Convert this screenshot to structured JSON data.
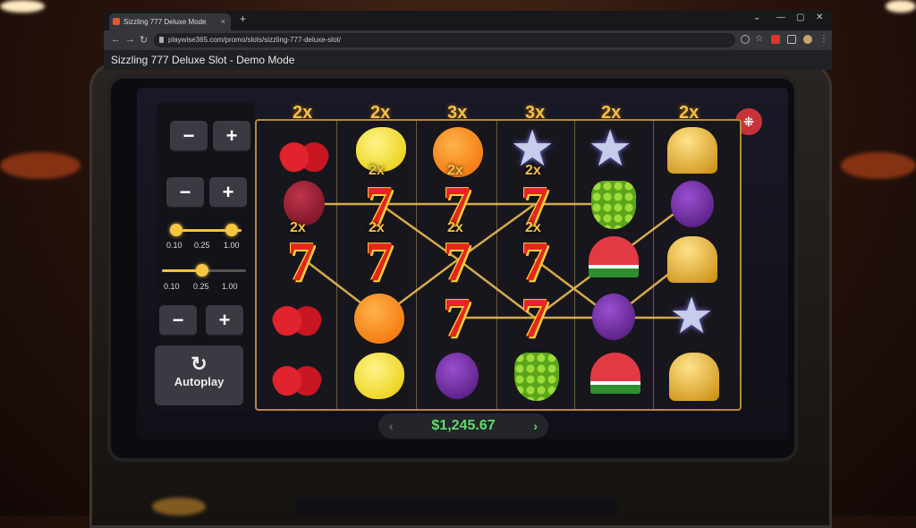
{
  "browser": {
    "tab_title": "Sizzling 777 Deluxe Mode",
    "tab_close": "×",
    "new_tab": "+",
    "window_controls": [
      "⌄",
      "—",
      "▢",
      "✕"
    ],
    "nav": {
      "back": "←",
      "forward": "→",
      "reload": "↻"
    },
    "url": "playwise365.com/promo/slots/sizzling-777-deluxe-slot/",
    "page_title": "Sizzling 777 Deluxe Slot - Demo Mode"
  },
  "controls": {
    "minus": "−",
    "plus": "+",
    "slider1": {
      "ticks": [
        "0.10",
        "0.25",
        "1.00"
      ],
      "value": 0.25
    },
    "slider2": {
      "ticks": [
        "0.10",
        "0.25",
        "1.00"
      ],
      "value": 0.25
    },
    "autoplay_icon": "↻",
    "autoplay_label": "Autoplay"
  },
  "reels": {
    "multipliers": [
      "2x",
      "2x",
      "3x",
      "3x",
      "2x",
      "2x"
    ],
    "symbol_multipliers": [
      "2x",
      "2x",
      "2x",
      "2x",
      "2x",
      "2x",
      "2x"
    ],
    "columns": [
      [
        "cherry",
        "plum",
        "seven",
        "cherry",
        "cherry"
      ],
      [
        "lemon",
        "seven",
        "seven",
        "orange",
        "lemon"
      ],
      [
        "orange",
        "seven",
        "seven",
        "seven",
        "plum"
      ],
      [
        "star",
        "seven",
        "seven",
        "seven",
        "grapes"
      ],
      [
        "star",
        "grapes",
        "watermelon",
        "plum",
        "watermelon"
      ],
      [
        "bell",
        "plum",
        "bell",
        "star",
        "bell"
      ]
    ],
    "info_icon": "⁜"
  },
  "balance": {
    "amount": "$1,245.67",
    "prev": "‹",
    "next": "›"
  },
  "colors": {
    "gold": "#f2c14a",
    "balance_green": "#5fdc6a",
    "seven_red": "#e5261c"
  }
}
